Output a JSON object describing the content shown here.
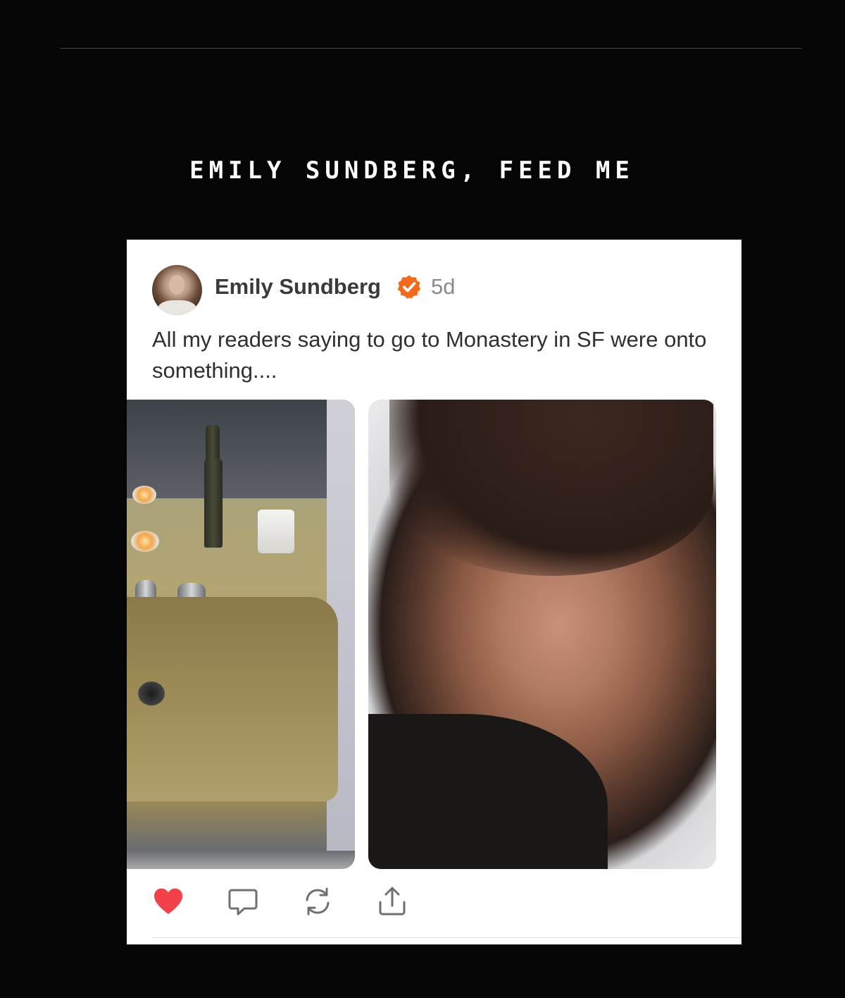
{
  "page": {
    "section_title": "EMILY SUNDBERG, FEED ME"
  },
  "post": {
    "author_name": "Emily Sundberg",
    "verified_icon": "verified-check-badge-icon",
    "age": "5d",
    "text": "All my readers saying to go to Monastery in SF were onto something....",
    "images": [
      {
        "name": "photo-sink",
        "description_icon": "image"
      },
      {
        "name": "photo-face",
        "description_icon": "image"
      }
    ]
  },
  "actions": [
    {
      "name": "like-button",
      "icon": "heart-icon",
      "state": "liked"
    },
    {
      "name": "comment-button",
      "icon": "comment-bubble-icon"
    },
    {
      "name": "restack-button",
      "icon": "refresh-arrows-icon"
    },
    {
      "name": "share-button",
      "icon": "share-upload-icon"
    }
  ],
  "colors": {
    "background": "#050505",
    "card": "#ffffff",
    "verified": "#f26a1b",
    "like": "#f2414a",
    "icon": "#6f6f6f",
    "title": "#ffffff"
  }
}
